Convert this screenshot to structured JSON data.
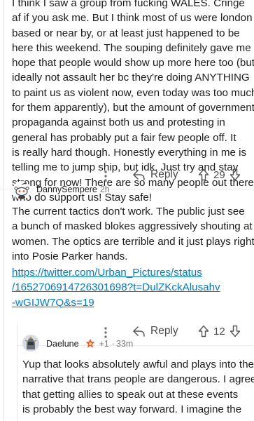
{
  "comment1": {
    "lines": [
      "I think I saw a group from fucking WALES. Cringe",
      "af if you ask me. But I think most of us were london",
      "based or near by, or at least just happened to be",
      "here this weekend. The souping definitely gave me",
      "hope that people would show up more here too (but",
      "ideally not assault her bc they're doing ANYTHING",
      "to paint us as violent now, even today was too much",
      "for them apparently), but the amount of government",
      "propaganda against both us and protesting in",
      "general has probably put a fair few people off. It",
      "is really hard though. Honestly everything in me is",
      "telling me to jump ship, but idk. Just try and stay",
      "strong for now! There are so many people out there",
      "who do support us! Stay safe!"
    ],
    "reply_label": "Reply",
    "score": "29"
  },
  "comment2": {
    "author": "DannySempere",
    "time": "2h",
    "lines": [
      "The current tactics don't work. The public just see",
      "a bunch of masked blokes aggressively shouting at",
      "women. The optics are terrible and it just plays right",
      "into Posie Parker hands."
    ],
    "link_lines": [
      "https://twitter.com/Urban_Pictures/status",
      "/1652706914726301698?t=DulZKckAlusahv",
      "-wGIJW7Q&s=19"
    ],
    "reply_label": "Reply",
    "score": "12"
  },
  "comment3": {
    "author": "Daelune",
    "award_count": "+1",
    "time": "33m",
    "separator": "·",
    "lines": [
      "Yup that looks absolutely awful and plays into the",
      "narrative that trans people are dangerous. I agree",
      "that getting allies to speak out at these events",
      "is probably the best way forward. I imagine the"
    ]
  },
  "colors": {
    "link": "#0079d3",
    "award": "#e8592a",
    "text": "#1c1c1c",
    "muted": "#7c7c7c"
  },
  "icons": [
    "more-dots-icon",
    "reply-arrow-icon",
    "upvote-icon",
    "downvote-icon",
    "award-icon",
    "snoo-avatar-icon"
  ]
}
